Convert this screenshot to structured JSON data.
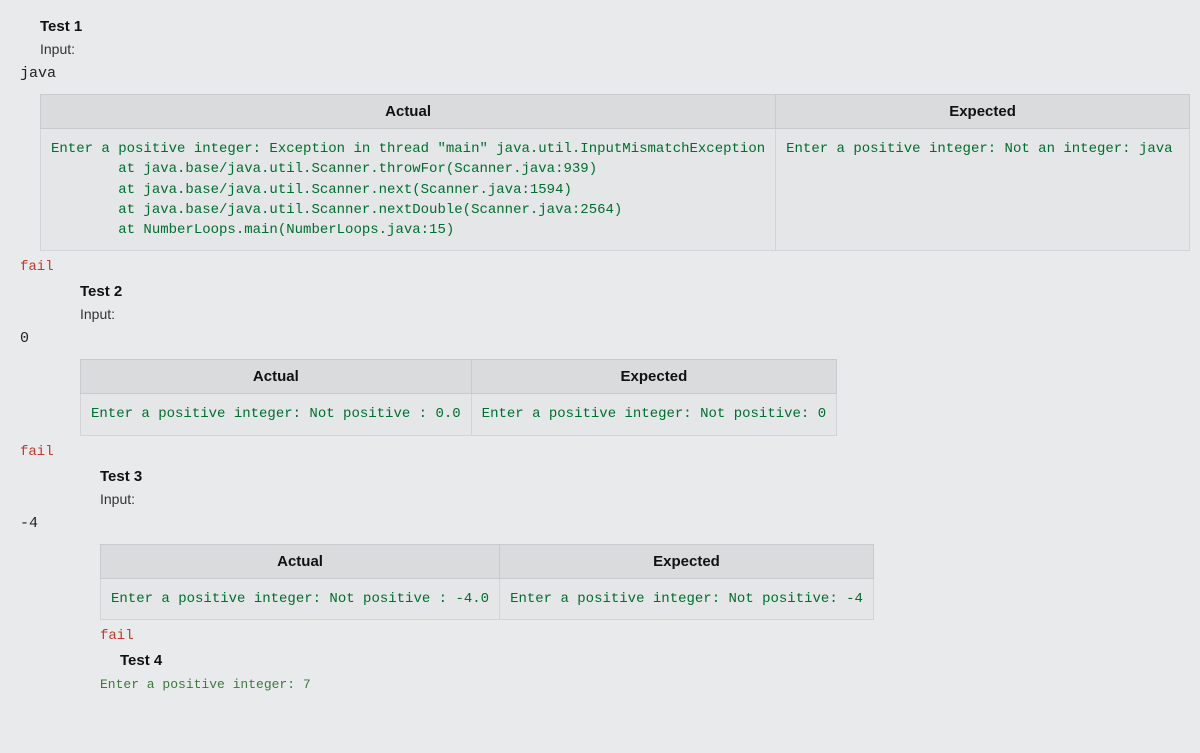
{
  "tests": [
    {
      "title": "Test 1",
      "inputLabel": "Input:",
      "inputValue": "java",
      "actualHeader": "Actual",
      "expectedHeader": "Expected",
      "actual": "Enter a positive integer: Exception in thread \"main\" java.util.InputMismatchException\n        at java.base/java.util.Scanner.throwFor(Scanner.java:939)\n        at java.base/java.util.Scanner.next(Scanner.java:1594)\n        at java.base/java.util.Scanner.nextDouble(Scanner.java:2564)\n        at NumberLoops.main(NumberLoops.java:15)",
      "expected": "Enter a positive integer: Not an integer: java",
      "status": "fail"
    },
    {
      "title": "Test 2",
      "inputLabel": "Input:",
      "inputValue": "0",
      "actualHeader": "Actual",
      "expectedHeader": "Expected",
      "actual": "Enter a positive integer: Not positive : 0.0",
      "expected": "Enter a positive integer: Not positive: 0",
      "status": "fail"
    },
    {
      "title": "Test 3",
      "inputLabel": "Input:",
      "inputValue": "-4",
      "actualHeader": "Actual",
      "expectedHeader": "Expected",
      "actual": "Enter a positive integer: Not positive : -4.0",
      "expected": "Enter a positive integer: Not positive: -4",
      "status": "fail"
    },
    {
      "title": "Test 4",
      "truncated": "Enter a positive integer: 7"
    }
  ]
}
